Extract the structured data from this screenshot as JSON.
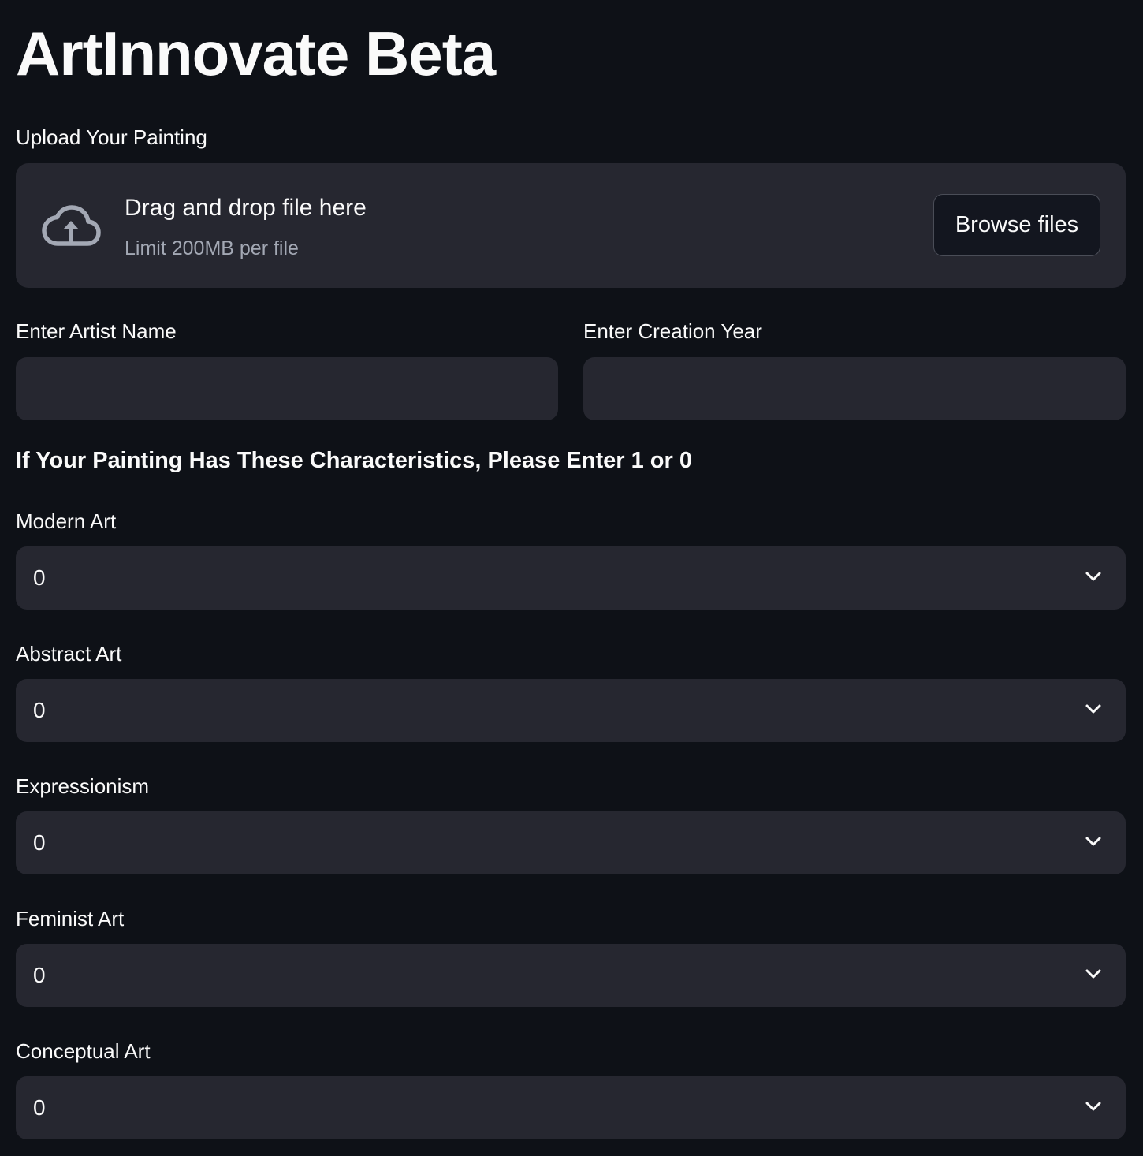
{
  "app": {
    "title": "ArtInnovate Beta"
  },
  "upload": {
    "label": "Upload Your Painting",
    "drop_text": "Drag and drop file here",
    "limit_text": "Limit 200MB per file",
    "browse_label": "Browse files",
    "icon": "cloud-upload-icon"
  },
  "fields": {
    "artist": {
      "label": "Enter Artist Name",
      "value": ""
    },
    "year": {
      "label": "Enter Creation Year",
      "value": ""
    }
  },
  "characteristics": {
    "heading": "If Your Painting Has These Characteristics, Please Enter 1 or 0",
    "items": [
      {
        "label": "Modern Art",
        "value": "0"
      },
      {
        "label": "Abstract Art",
        "value": "0"
      },
      {
        "label": "Expressionism",
        "value": "0"
      },
      {
        "label": "Feminist Art",
        "value": "0"
      },
      {
        "label": "Conceptual Art",
        "value": "0"
      }
    ]
  },
  "colors": {
    "background": "#0e1117",
    "surface": "#262730",
    "text": "#fafafa",
    "muted_text": "#a3a8b4"
  }
}
